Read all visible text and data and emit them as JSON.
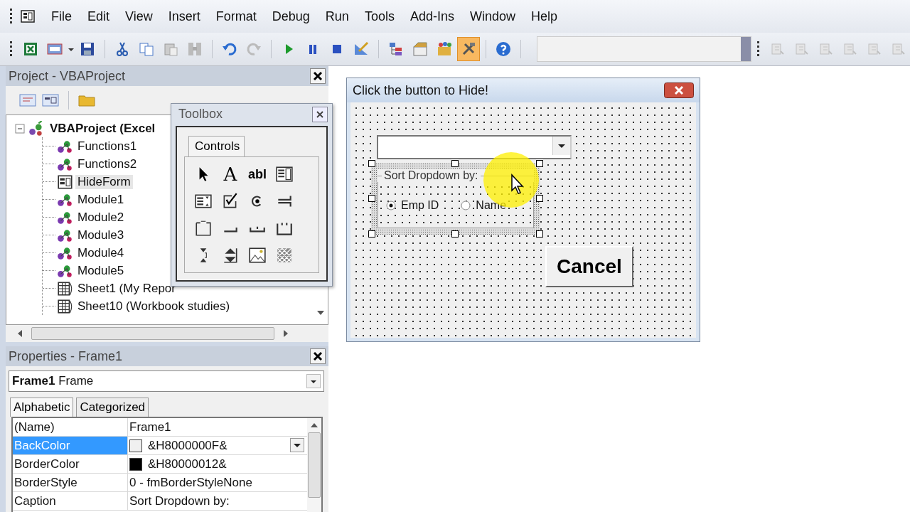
{
  "menu": [
    "File",
    "Edit",
    "View",
    "Insert",
    "Format",
    "Debug",
    "Run",
    "Tools",
    "Add-Ins",
    "Window",
    "Help"
  ],
  "toolbar": [
    {
      "kind": "excel",
      "selected": false
    },
    {
      "kind": "userform",
      "selected": false
    },
    {
      "kind": "save",
      "selected": false
    },
    {
      "kind": "cut",
      "selected": false
    },
    {
      "kind": "copy",
      "selected": false
    },
    {
      "kind": "paste",
      "selected": false
    },
    {
      "kind": "find",
      "selected": false
    },
    {
      "kind": "undo",
      "selected": false
    },
    {
      "kind": "redo",
      "selected": false
    },
    {
      "kind": "run",
      "selected": false
    },
    {
      "kind": "pause",
      "selected": false
    },
    {
      "kind": "stop",
      "selected": false
    },
    {
      "kind": "design",
      "selected": false
    },
    {
      "kind": "explorer",
      "selected": false
    },
    {
      "kind": "properties",
      "selected": false
    },
    {
      "kind": "browser",
      "selected": false
    },
    {
      "kind": "toolbox",
      "selected": true
    },
    {
      "kind": "help",
      "selected": false
    }
  ],
  "project": {
    "title": "Project - VBAProject",
    "tree": [
      {
        "label": "VBAProject (Excel",
        "kind": "project",
        "expanded": true,
        "selected": false,
        "children": [
          {
            "label": "Functions1",
            "kind": "module",
            "selected": false
          },
          {
            "label": "Functions2",
            "kind": "module",
            "selected": false
          },
          {
            "label": "HideForm",
            "kind": "form",
            "selected": true
          },
          {
            "label": "Module1",
            "kind": "module",
            "selected": false
          },
          {
            "label": "Module2",
            "kind": "module",
            "selected": false
          },
          {
            "label": "Module3",
            "kind": "module",
            "selected": false
          },
          {
            "label": "Module4",
            "kind": "module",
            "selected": false
          },
          {
            "label": "Module5",
            "kind": "module",
            "selected": false
          },
          {
            "label": "Sheet1 (My Repor",
            "kind": "sheet",
            "selected": false
          },
          {
            "label": "Sheet10 (Workbook studies)",
            "kind": "sheet",
            "selected": false
          }
        ]
      }
    ]
  },
  "toolbox": {
    "title": "Toolbox",
    "tab": "Controls",
    "tools": [
      {
        "kind": "pointer"
      },
      {
        "kind": "label",
        "glyph": "A"
      },
      {
        "kind": "textbox",
        "glyph": "abl"
      },
      {
        "kind": "combobox"
      },
      {
        "kind": "listbox"
      },
      {
        "kind": "checkbox"
      },
      {
        "kind": "option"
      },
      {
        "kind": "toggle"
      },
      {
        "kind": "frame"
      },
      {
        "kind": "button"
      },
      {
        "kind": "tabstrip"
      },
      {
        "kind": "multipage"
      },
      {
        "kind": "scrollbar"
      },
      {
        "kind": "spin"
      },
      {
        "kind": "image"
      },
      {
        "kind": "refedit"
      }
    ]
  },
  "user_form": {
    "title": "Click the button to Hide!",
    "frame": {
      "caption": "Sort Dropdown by:",
      "selected": true
    },
    "options": [
      {
        "label": "Emp ID",
        "selected": true
      },
      {
        "label": "Name",
        "selected": false
      }
    ],
    "button": "Cancel"
  },
  "properties": {
    "title": "Properties - Frame1",
    "object": {
      "name": "Frame1",
      "type": "Frame"
    },
    "tabs": [
      {
        "label": "Alphabetic",
        "selected": true
      },
      {
        "label": "Categorized",
        "selected": false
      }
    ],
    "rows": [
      {
        "name": "(Name)",
        "value": "Frame1",
        "selected": false
      },
      {
        "name": "BackColor",
        "value": "&H8000000F&",
        "color": "#f0f0f0",
        "selected": true
      },
      {
        "name": "BorderColor",
        "value": "&H80000012&",
        "color": "#000000",
        "selected": false
      },
      {
        "name": "BorderStyle",
        "value": "0 - fmBorderStyleNone",
        "selected": false
      },
      {
        "name": "Caption",
        "value": "Sort Dropdown by:",
        "selected": false
      }
    ]
  }
}
